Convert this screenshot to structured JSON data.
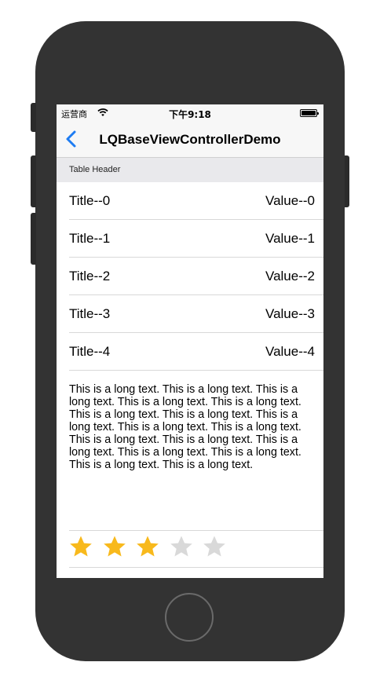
{
  "status_bar": {
    "carrier": "运营商",
    "time": "下午9:18"
  },
  "nav": {
    "title": "LQBaseViewControllerDemo"
  },
  "table": {
    "header": "Table Header",
    "rows": [
      {
        "title": "Title--0",
        "value": "Value--0"
      },
      {
        "title": "Title--1",
        "value": "Value--1"
      },
      {
        "title": "Title--2",
        "value": "Value--2"
      },
      {
        "title": "Title--3",
        "value": "Value--3"
      },
      {
        "title": "Title--4",
        "value": "Value--4"
      }
    ],
    "long_text": "This is a long text. This is a long text. This is a long text. This is a long text. This is a long text. This is a long text. This is a long text. This is a long text. This is a long text. This is a long text. This is a long text. This is a long text. This is a long text. This is a long text. This is a long text. This is a long text. This is a long text.",
    "rating": {
      "value": 3,
      "max": 5
    }
  },
  "colors": {
    "star_filled": "#F8B91C",
    "star_empty": "#D9D9D9",
    "tint": "#1E7CF2"
  }
}
